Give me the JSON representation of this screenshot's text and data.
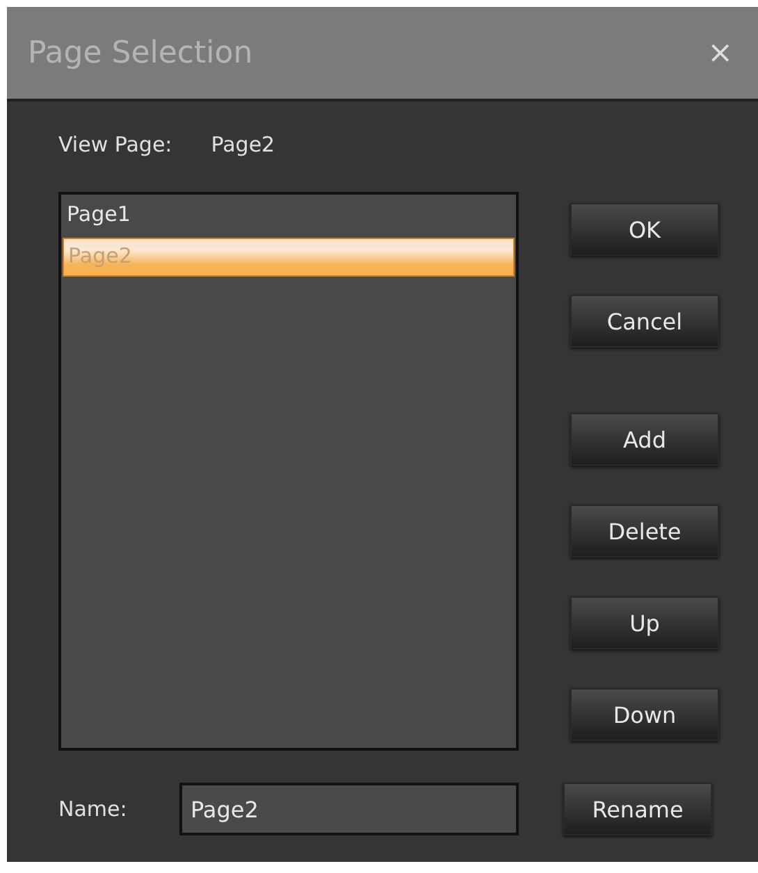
{
  "window": {
    "title": "Page Selection",
    "close": "×"
  },
  "view_page": {
    "label": "View Page:",
    "value": "Page2"
  },
  "pages": [
    {
      "label": "Page1",
      "selected": false
    },
    {
      "label": "Page2",
      "selected": true
    }
  ],
  "dialog_buttons": [
    "OK",
    "Cancel"
  ],
  "list_buttons": [
    "Add",
    "Delete",
    "Up",
    "Down"
  ],
  "name_field": {
    "label": "Name:",
    "value": "Page2"
  },
  "rename_button": "Rename"
}
